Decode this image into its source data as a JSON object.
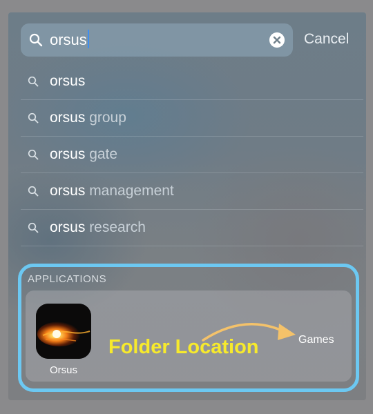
{
  "search": {
    "query": "orsus",
    "cancel_label": "Cancel"
  },
  "suggestions": [
    {
      "bold": "orsus",
      "rest": ""
    },
    {
      "bold": "orsus",
      "rest": " group"
    },
    {
      "bold": "orsus",
      "rest": " gate"
    },
    {
      "bold": "orsus",
      "rest": " management"
    },
    {
      "bold": "orsus",
      "rest": " research"
    }
  ],
  "applications": {
    "header": "APPLICATIONS",
    "app_name": "Orsus",
    "folder": "Games",
    "annotation": "Folder Location"
  },
  "colors": {
    "highlight_border": "#6cc8f2",
    "annotation": "#f7ea2c",
    "caret": "#3d8ef2"
  },
  "icons": [
    "search-icon",
    "clear-icon",
    "app-icon"
  ]
}
